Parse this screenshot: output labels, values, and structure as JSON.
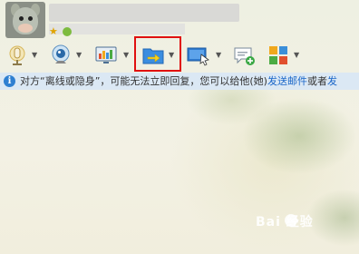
{
  "header": {
    "star_glyph": "★",
    "avatar_icon": "deer-avatar-icon"
  },
  "toolbar": {
    "items": [
      {
        "name": "voice",
        "icon": "microphone-icon",
        "arrow": "▼"
      },
      {
        "name": "video",
        "icon": "webcam-icon",
        "arrow": "▼"
      },
      {
        "name": "remote-desktop",
        "icon": "monitor-chart-icon",
        "arrow": "▼"
      },
      {
        "name": "send-file",
        "icon": "folder-arrow-icon",
        "arrow": "▼"
      },
      {
        "name": "screen-share",
        "icon": "screen-pointer-icon",
        "arrow": "▼"
      },
      {
        "name": "new-discussion",
        "icon": "chat-plus-icon",
        "arrow": ""
      },
      {
        "name": "apps",
        "icon": "app-grid-icon",
        "arrow": "▼"
      }
    ],
    "highlight_color": "#e01010"
  },
  "notice": {
    "icon_glyph": "i",
    "text_prefix": "对方“离线或隐身”，可能无法立即回复，您可以给他(她)",
    "link_email": "发送邮件",
    "text_middle": "或者",
    "link_more": "发"
  },
  "watermark": {
    "text": "Bai  经验"
  },
  "colors": {
    "link": "#1a66c8",
    "info_bg": "#dbe8f4",
    "info_icon": "#2e7fd1"
  }
}
